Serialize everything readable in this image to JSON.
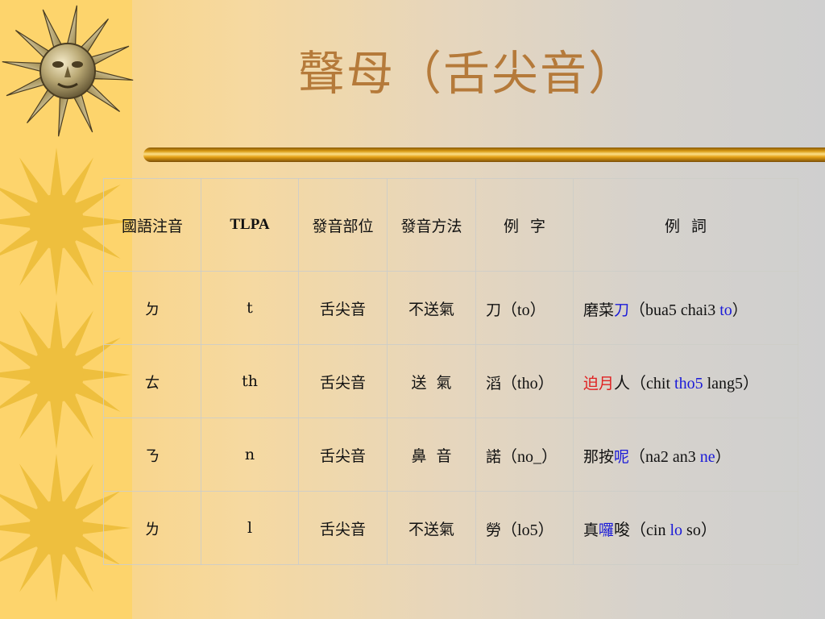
{
  "slide": {
    "title": "聲母（舌尖音）"
  },
  "table": {
    "headers": {
      "zhuyin": "國語注音",
      "tlpa": "TLPA",
      "place": "發音部位",
      "manner": "發音方法",
      "example_char_a": "例",
      "example_char_b": "字",
      "example_word_a": "例",
      "example_word_b": "詞"
    },
    "rows": [
      {
        "zhuyin": "ㄉ",
        "tlpa": "t",
        "place": "舌尖音",
        "manner": "不送氣",
        "char": "刀",
        "char_roman": "（to）",
        "word": [
          {
            "text": "磨菜",
            "color": ""
          },
          {
            "text": "刀",
            "color": "blue"
          },
          {
            "text": "（bua5 chai3 ",
            "color": ""
          },
          {
            "text": "to",
            "color": "blue"
          },
          {
            "text": "）",
            "color": ""
          }
        ]
      },
      {
        "zhuyin": "ㄊ",
        "tlpa": "th",
        "place": "舌尖音",
        "manner": "送  氣",
        "char": "滔",
        "char_roman": "（tho）",
        "word": [
          {
            "text": "迫",
            "color": "red"
          },
          {
            "text": "月",
            "color": "red"
          },
          {
            "text": "人（chit ",
            "color": ""
          },
          {
            "text": "tho5",
            "color": "blue"
          },
          {
            "text": " lang5）",
            "color": ""
          }
        ]
      },
      {
        "zhuyin": "ㄋ",
        "tlpa": "n",
        "place": "舌尖音",
        "manner": "鼻  音",
        "char": "諾",
        "char_roman": "（no_）",
        "word": [
          {
            "text": "那按",
            "color": ""
          },
          {
            "text": "呢",
            "color": "blue"
          },
          {
            "text": "（na2 an3 ",
            "color": ""
          },
          {
            "text": "ne",
            "color": "blue"
          },
          {
            "text": "）",
            "color": ""
          }
        ]
      },
      {
        "zhuyin": "ㄌ",
        "tlpa": "l",
        "place": "舌尖音",
        "manner": "不送氣",
        "char": "勞",
        "char_roman": "（lo5）",
        "word": [
          {
            "text": "真",
            "color": ""
          },
          {
            "text": "囉",
            "color": "blue"
          },
          {
            "text": "唆（cin ",
            "color": ""
          },
          {
            "text": "lo",
            "color": "blue"
          },
          {
            "text": " so）",
            "color": ""
          }
        ]
      }
    ]
  },
  "colors": {
    "title": "#b57a3a",
    "blue": "#1a1ad8",
    "red": "#e02222"
  },
  "decorations": {
    "top_icon": "sun-face-icon",
    "side_icons": [
      "sun-icon",
      "sun-icon",
      "sun-icon"
    ]
  }
}
